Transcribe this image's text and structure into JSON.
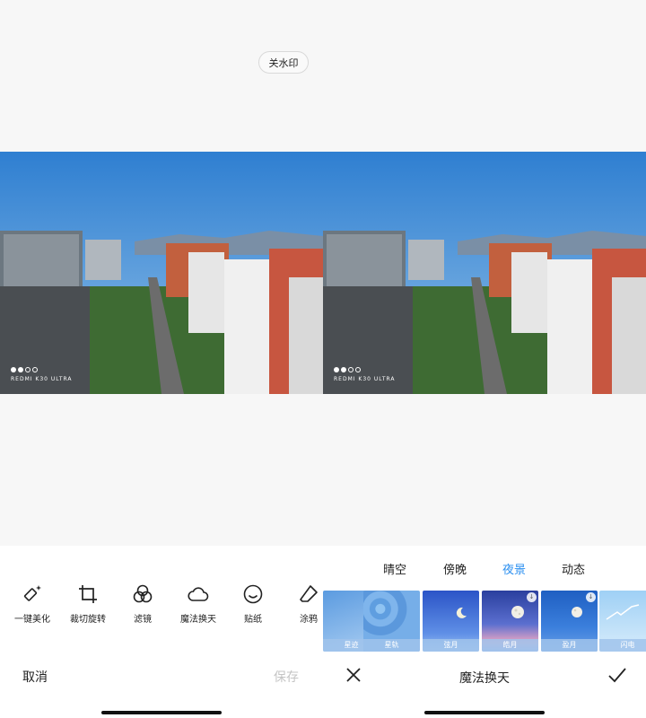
{
  "watermark_toggle": "关水印",
  "photo": {
    "camera_mark": "REDMI K30 ULTRA"
  },
  "edit_panel": {
    "tools": [
      {
        "label": "一键美化",
        "icon": "magic-wand-icon"
      },
      {
        "label": "裁切旋转",
        "icon": "crop-icon"
      },
      {
        "label": "滤镜",
        "icon": "filter-circles-icon"
      },
      {
        "label": "魔法换天",
        "icon": "cloud-icon"
      },
      {
        "label": "贴纸",
        "icon": "smiley-icon"
      },
      {
        "label": "涂鸦",
        "icon": "eraser-icon"
      }
    ],
    "cancel_label": "取消",
    "save_label": "保存"
  },
  "sky_panel": {
    "tabs": [
      {
        "label": "晴空",
        "active": false
      },
      {
        "label": "傍晚",
        "active": false
      },
      {
        "label": "夜景",
        "active": true
      },
      {
        "label": "动态",
        "active": false
      }
    ],
    "presets": [
      {
        "label": "星迹",
        "download": true
      },
      {
        "label": "星轨",
        "download": false
      },
      {
        "label": "弦月",
        "download": false
      },
      {
        "label": "皓月",
        "download": true
      },
      {
        "label": "盈月",
        "download": true
      },
      {
        "label": "闪电",
        "download": false
      }
    ],
    "title": "魔法换天",
    "download_glyph": "↓"
  },
  "colors": {
    "accent": "#2b8ff0",
    "disabled_text": "#c4c4c4",
    "text": "#222222",
    "canvas_bg": "#f7f7f7"
  }
}
